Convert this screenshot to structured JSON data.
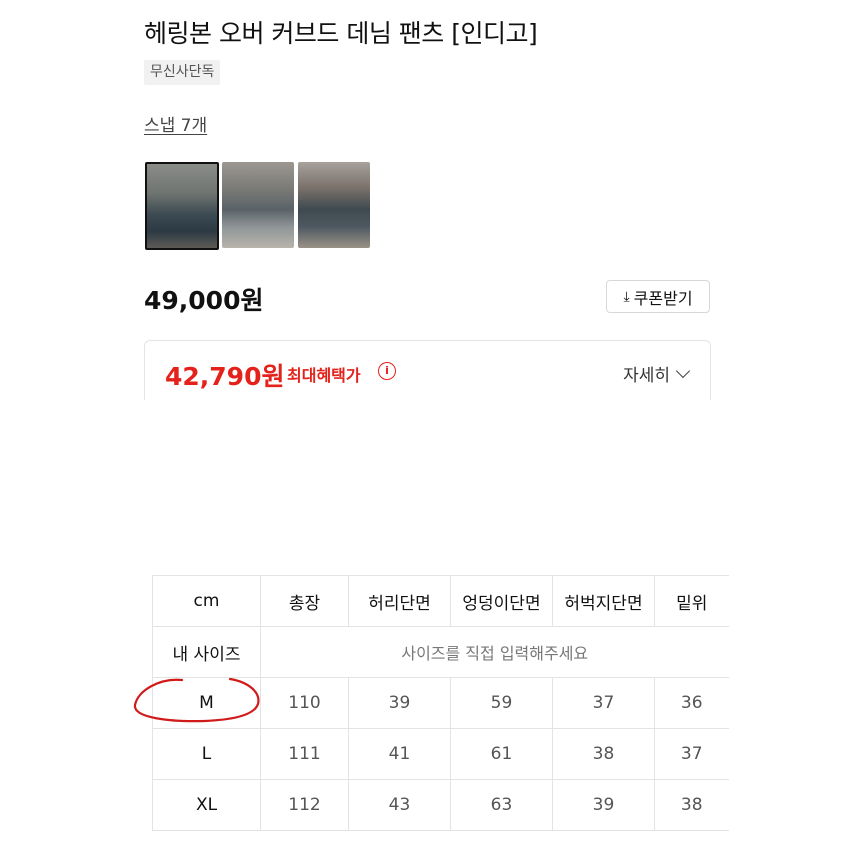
{
  "product": {
    "title": "헤링본 오버 커브드 데님 팬츠 [인디고]",
    "badge": "무신사단독",
    "snap_link": "스냅 7개",
    "thumbnails": [
      "snap-photo-1",
      "snap-photo-2",
      "snap-photo-3"
    ]
  },
  "pricing": {
    "price": "49,000원",
    "coupon_label": "쿠폰받기",
    "sale_price": "42,790원",
    "max_benefit_label": "최대혜택가",
    "detail_label": "자세히"
  },
  "size_table": {
    "columns": [
      "cm",
      "총장",
      "허리단면",
      "엉덩이단면",
      "허벅지단면",
      "밑위"
    ],
    "my_size_label": "내 사이즈",
    "my_size_placeholder": "사이즈를 직접 입력해주세요",
    "rows": [
      {
        "size": "M",
        "values": [
          "110",
          "39",
          "59",
          "37",
          "36"
        ]
      },
      {
        "size": "L",
        "values": [
          "111",
          "41",
          "61",
          "38",
          "37"
        ]
      },
      {
        "size": "XL",
        "values": [
          "112",
          "43",
          "63",
          "39",
          "38"
        ]
      }
    ]
  },
  "colors": {
    "accent_red": "#e4221b",
    "annotation_red": "#d11a1a"
  }
}
